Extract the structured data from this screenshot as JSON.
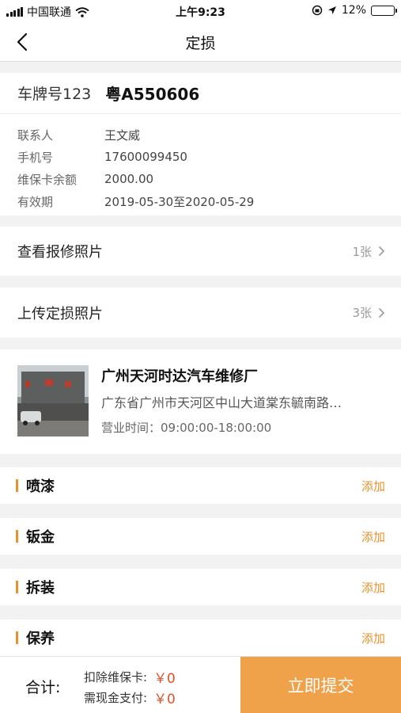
{
  "status_bar": {
    "carrier": "中国联通",
    "time": "上午9:23",
    "battery": "12%",
    "battery_level": 0.12
  },
  "nav": {
    "title": "定损"
  },
  "vehicle": {
    "plate_label": "车牌号123",
    "plate_number": "粤A550606",
    "rows": [
      {
        "label": "联系人",
        "value": "王文威"
      },
      {
        "label": "手机号",
        "value": "17600099450"
      },
      {
        "label": "维保卡余额",
        "value": "2000.00"
      },
      {
        "label": "有效期",
        "value": "2019-05-30至2020-05-29"
      }
    ]
  },
  "repair_photos": {
    "label": "查看报修照片",
    "count": "1张"
  },
  "damage_photos": {
    "label": "上传定损照片",
    "count": "3张"
  },
  "shop": {
    "name": "广州天河时达汽车维修厂",
    "address": "广东省广州市天河区中山大道棠东毓南路…",
    "hours": "营业时间：09:00:00-18:00:00"
  },
  "categories": [
    {
      "label": "喷漆",
      "action": "添加"
    },
    {
      "label": "钣金",
      "action": "添加"
    },
    {
      "label": "拆装",
      "action": "添加"
    },
    {
      "label": "保养",
      "action": "添加"
    }
  ],
  "footer": {
    "total_label": "合计:",
    "card_deduct_label": "扣除维保卡:",
    "card_deduct_amount": "￥0",
    "cash_label": "需现金支付:",
    "cash_amount": "￥0",
    "submit_label": "立即提交"
  },
  "colors": {
    "accent": "#e8922e",
    "submit_bg": "#f0a24b",
    "amount": "#e2512d"
  }
}
